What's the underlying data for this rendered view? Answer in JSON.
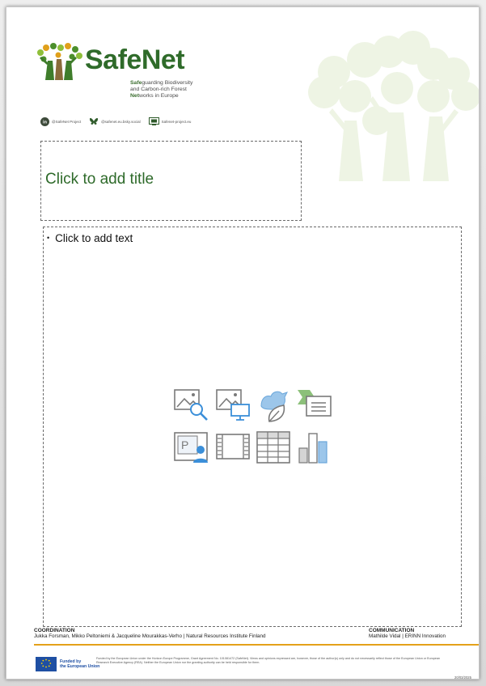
{
  "logo": {
    "wordmark": "SafeNet",
    "sub_bold_1": "Safe",
    "sub_rest_1": "guarding Biodiversity",
    "sub_line_2": "and Carbon-rich Forest",
    "sub_bold_3": "Net",
    "sub_rest_3": "works in Europe"
  },
  "socials": [
    {
      "icon": "linkedin-icon",
      "label": "@SafeNet Project"
    },
    {
      "icon": "bluesky-icon",
      "label": "@safenet.eu.bsky.social"
    },
    {
      "icon": "website-icon",
      "label": "Safenet-project.eu"
    }
  ],
  "title_placeholder": "Click to add title",
  "body_placeholder": {
    "bullet": "•",
    "text": "Click to add text"
  },
  "insert_icons": [
    "stock-images-icon",
    "picture-icon",
    "icons-insert-icon",
    "smartart-icon",
    "cameo-icon",
    "video-icon",
    "table-icon",
    "chart-icon"
  ],
  "footer": {
    "coordination_heading": "COORDINATION",
    "coordination_text": "Jukka Forsman, Mikko Peltoniemi & Jacqueline Mourakkas-Verho | Natural Resources Institute Finland",
    "communication_heading": "COMMUNICATION",
    "communication_text": "Mathilde Vidal | ERINN Innovation",
    "eu_line_1": "Funded by",
    "eu_line_2": "the European Union",
    "disclaimer": "Funded by the European Union under the Horizon Europe Programme, Grant Agreement No. 101081472 (SafeNet). Views and opinions expressed are, however, those of the author(s) only and do not necessarily reflect those of the European Union or European Research Executive Agency (REA). Neither the European Union nor the granting authority can be held responsible for them.",
    "date": "20/03/2025"
  },
  "colors": {
    "brand_green": "#2f6b2a",
    "accent_orange": "#e4a11a",
    "eu_blue": "#1e4fa3",
    "icon_blue": "#3b8fd9"
  }
}
